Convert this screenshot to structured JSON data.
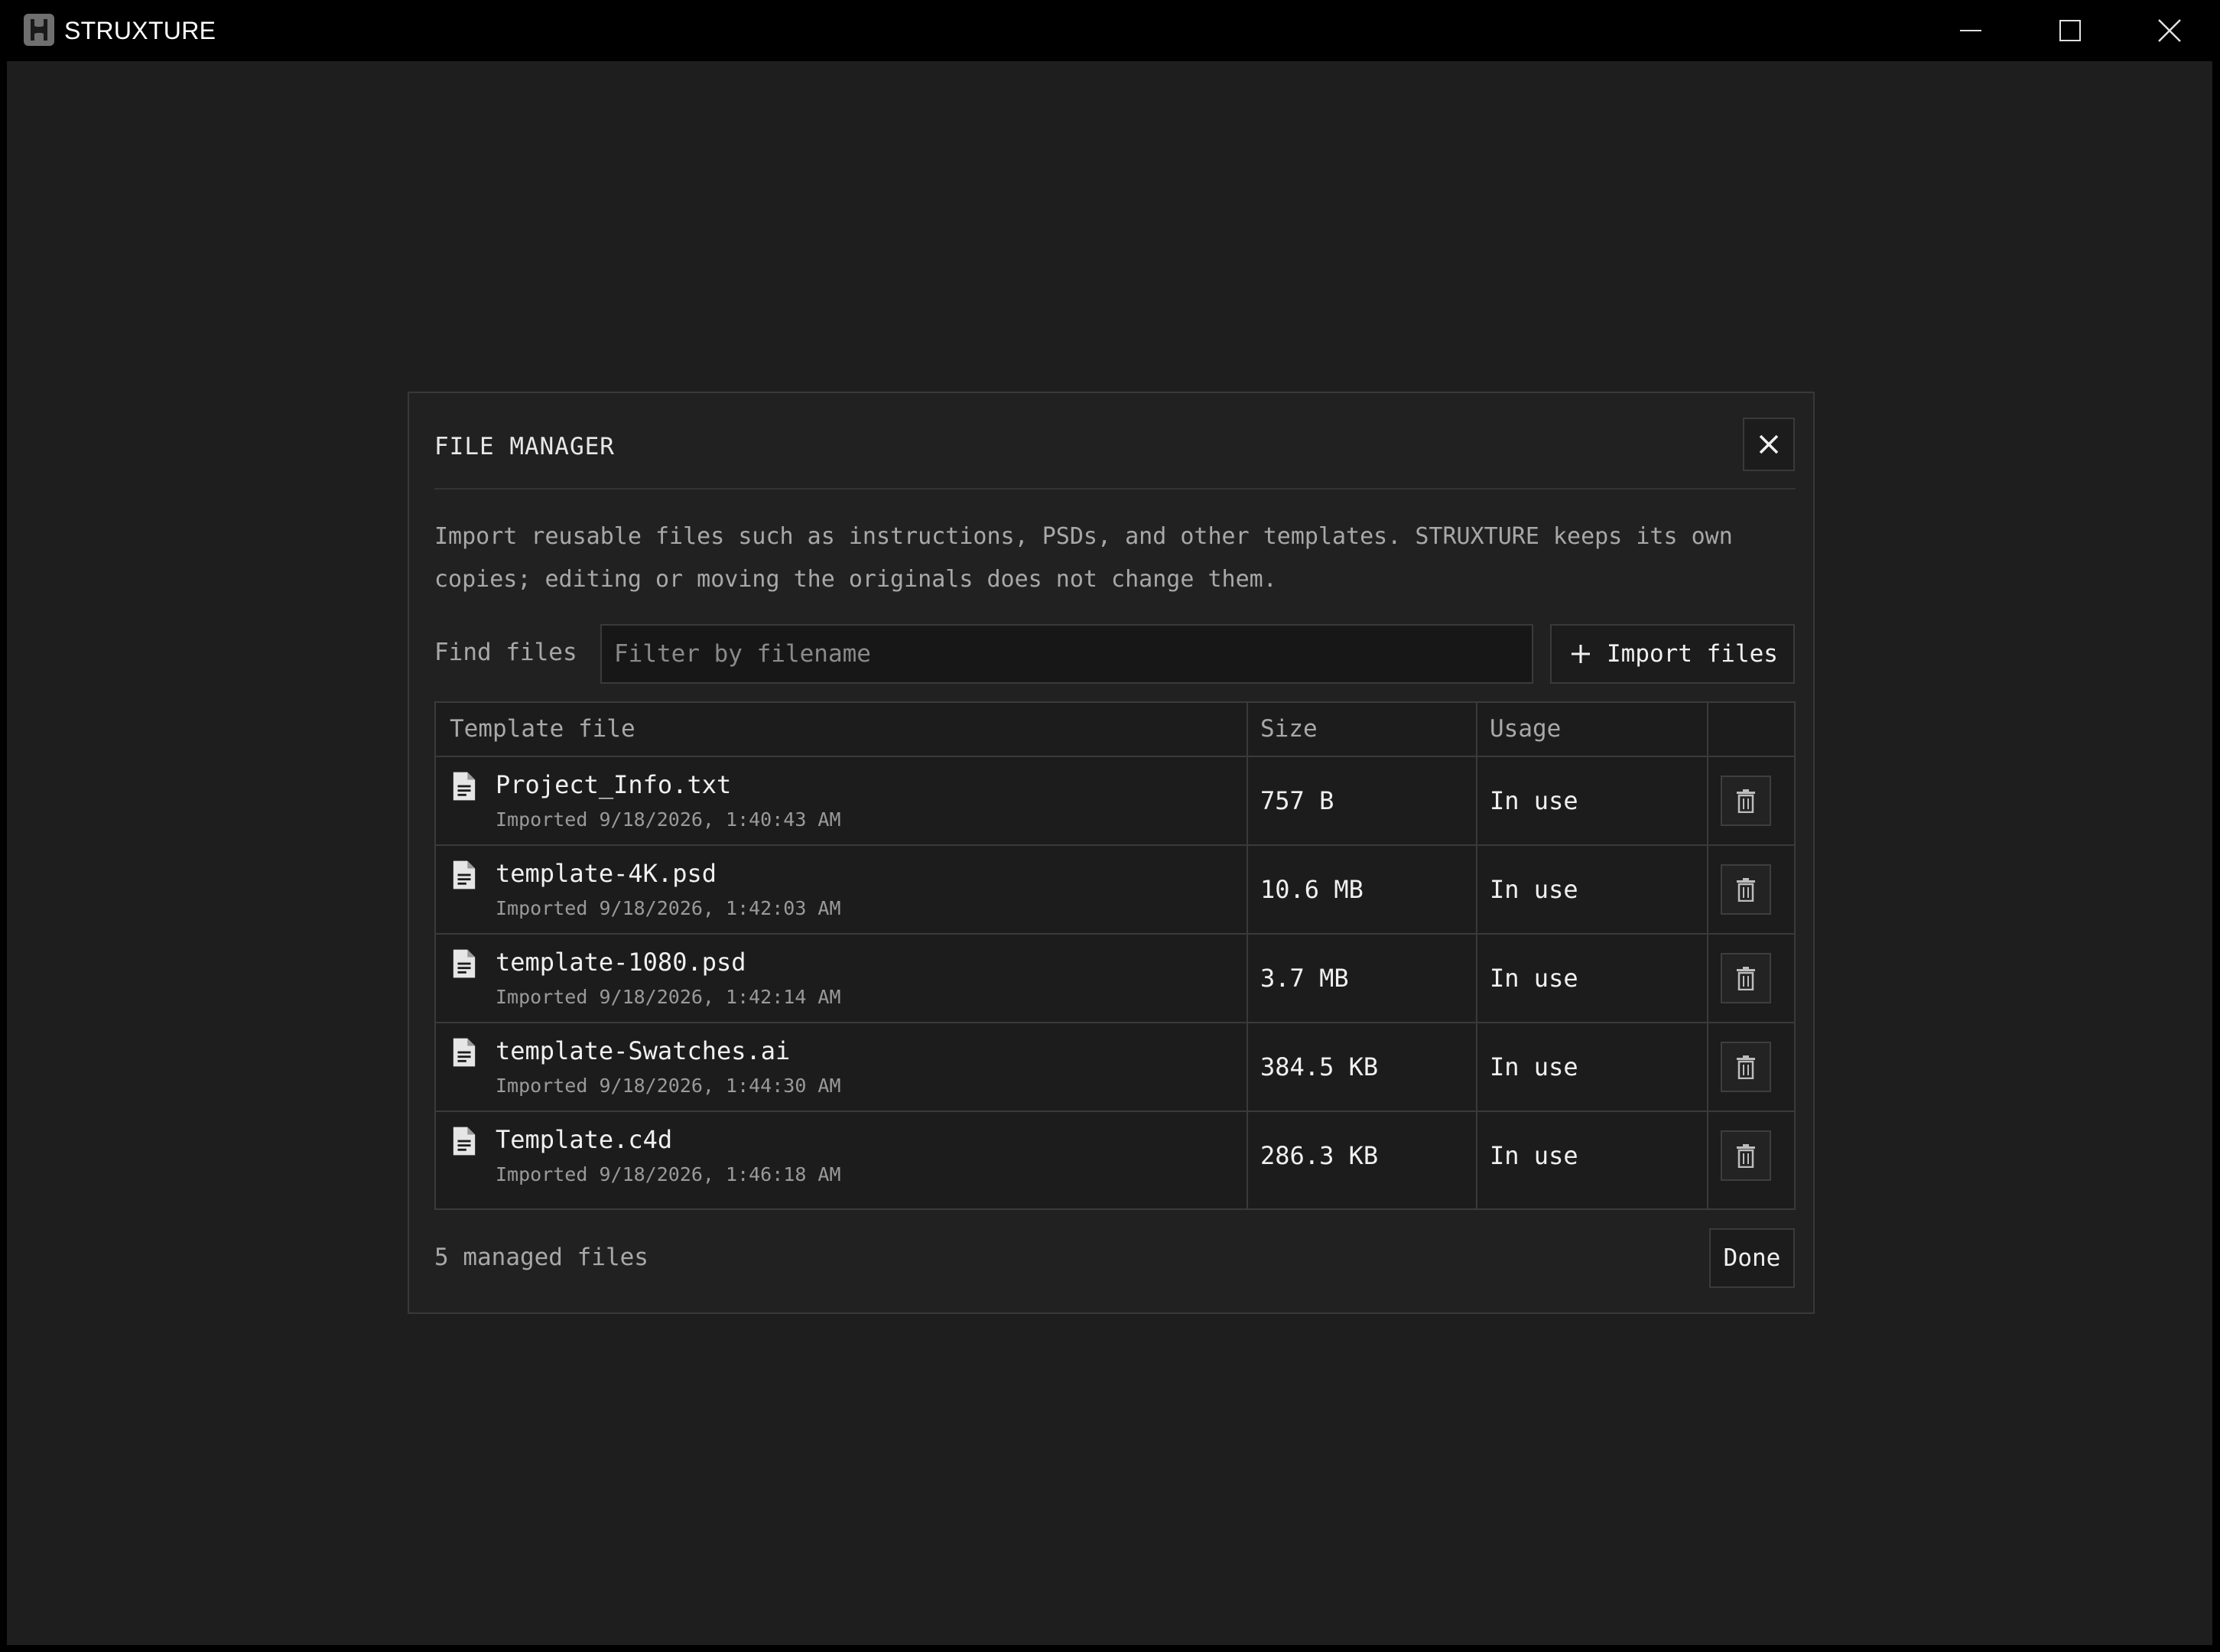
{
  "app": {
    "title": "STRUXTURE",
    "logo_icon": "struxture-logo-icon",
    "controls": [
      "minimize-icon",
      "maximize-icon",
      "close-icon"
    ]
  },
  "modal": {
    "title": "FILE MANAGER",
    "description": "Import reusable files such as instructions, PSDs, and other templates. STRUXTURE keeps its own copies; editing or moving the originals does not change them.",
    "find_label": "Find files",
    "search": {
      "placeholder": "Filter by filename",
      "value": ""
    },
    "import_label": "Import files",
    "table": {
      "headers": {
        "file": "Template file",
        "size": "Size",
        "usage": "Usage"
      },
      "rows": [
        {
          "name": "Project_Info.txt",
          "imported": "Imported 9/18/2026, 1:40:43 AM",
          "size": "757 B",
          "usage": "In use"
        },
        {
          "name": "template-4K.psd",
          "imported": "Imported 9/18/2026, 1:42:03 AM",
          "size": "10.6 MB",
          "usage": "In use"
        },
        {
          "name": "template-1080.psd",
          "imported": "Imported 9/18/2026, 1:42:14 AM",
          "size": "3.7 MB",
          "usage": "In use"
        },
        {
          "name": "template-Swatches.ai",
          "imported": "Imported 9/18/2026, 1:44:30 AM",
          "size": "384.5 KB",
          "usage": "In use"
        },
        {
          "name": "Template.c4d",
          "imported": "Imported 9/18/2026, 1:46:18 AM",
          "size": "286.3 KB",
          "usage": "In use"
        }
      ]
    },
    "footer": {
      "count_text": "5 managed files",
      "done_label": "Done"
    }
  },
  "colors": {
    "background": "#1e1e1e",
    "titlebar": "#000000",
    "modal": "#212121",
    "border": "#3a3a3a",
    "text_primary": "#f0f0f0",
    "text_muted": "#a8a8a8"
  }
}
